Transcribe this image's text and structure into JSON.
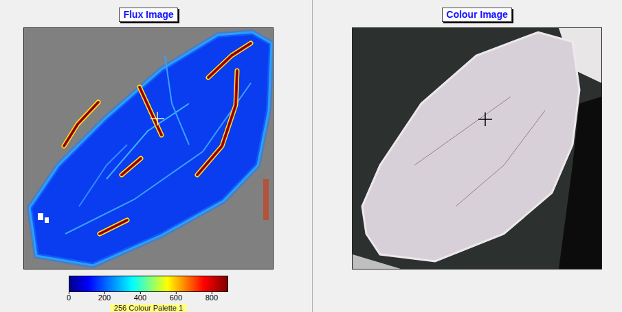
{
  "panels": [
    {
      "title": "Flux Image"
    },
    {
      "title": "Colour Image"
    }
  ],
  "colour_bar": {
    "ticks": [
      "0",
      "200",
      "400",
      "600",
      "800"
    ],
    "palette": "256 Colour Palette 1"
  }
}
